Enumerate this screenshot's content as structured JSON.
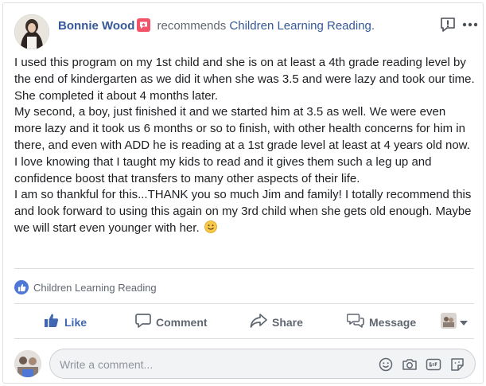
{
  "post": {
    "author": "Bonnie Wood",
    "verb": "recommends",
    "page_name": "Children Learning Reading.",
    "paragraphs": [
      "I used this program on my 1st child and she is on at least a 4th grade reading level by the end of kindergarten as we did it when she was 3.5 and were lazy and took our time. She completed it about 4 months later.",
      "My second, a boy, just finished it and we started him at 3.5 as well. We were even more lazy and it took us 6 months or so to finish, with other health concerns for him in there, and even with ADD he is reading at a 1st grade level at least at 4 years old now.",
      "I love knowing that I taught my kids to read and it gives them such a leg up and confidence boost that transfers to many other aspects of their life.",
      "I am so thankful for this...THANK you so much Jim and family! I totally recommend this and look forward to using this again on my 3rd child when she gets old enough. Maybe we will start even younger with her."
    ],
    "tagged_page": "Children Learning Reading"
  },
  "actions": {
    "like": "Like",
    "comment": "Comment",
    "share": "Share",
    "message": "Message"
  },
  "composer": {
    "placeholder": "Write a comment..."
  },
  "colors": {
    "link": "#365899",
    "like_blue": "#4267b2",
    "recommend_badge": "#f35369",
    "muted": "#606770"
  },
  "icons": [
    "recommend-badge-icon",
    "report-icon",
    "more-icon",
    "like-icon",
    "comment-icon",
    "share-icon",
    "message-icon",
    "smile-emoji-icon",
    "emoji-icon",
    "camera-icon",
    "gif-icon",
    "sticker-icon",
    "caret-down-icon"
  ]
}
